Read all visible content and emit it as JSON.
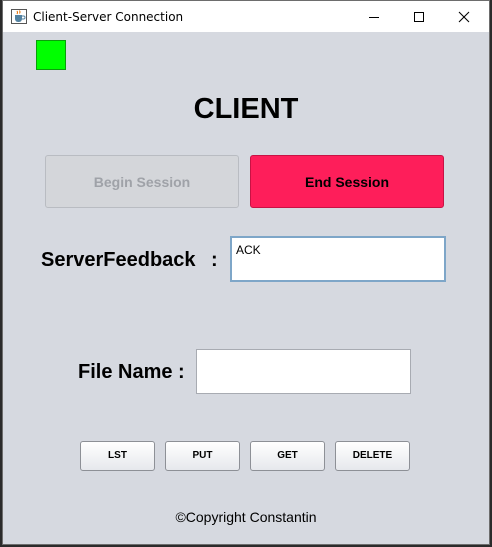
{
  "window": {
    "title": "Client-Server Connection",
    "icons": {
      "app": "java-cup-icon",
      "minimize": "minimize-icon",
      "maximize": "maximize-icon",
      "close": "close-icon"
    }
  },
  "status": {
    "indicator_color": "#00ff00",
    "connected": true
  },
  "heading": "CLIENT",
  "buttons": {
    "begin_session": "Begin Session",
    "begin_session_enabled": false,
    "end_session": "End Session",
    "end_session_color": "#fe1e5a"
  },
  "feedback": {
    "label": "ServerFeedback",
    "colon": ":",
    "value": "ACK"
  },
  "file": {
    "label": "File Name :",
    "value": ""
  },
  "actions": {
    "lst": "LST",
    "put": "PUT",
    "get": "GET",
    "delete": "DELETE"
  },
  "footer": {
    "copyright": "©Copyright Constantin"
  }
}
